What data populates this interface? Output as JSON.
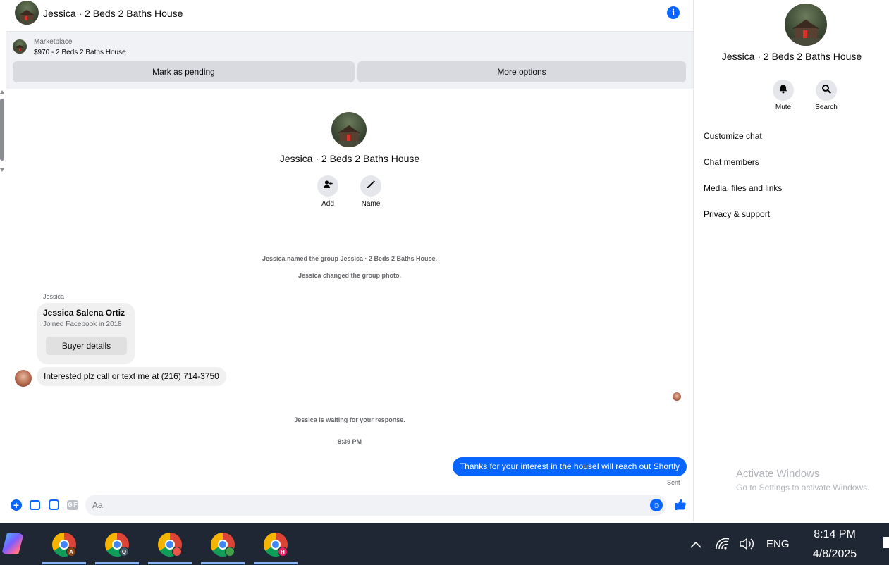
{
  "header": {
    "title": "Jessica · 2 Beds 2 Baths House"
  },
  "marketplace": {
    "label": "Marketplace",
    "listing": "$970 - 2 Beds 2 Baths House",
    "pending_button": "Mark as pending",
    "options_button": "More options"
  },
  "intro": {
    "title": "Jessica · 2 Beds 2 Baths House",
    "add_label": "Add",
    "name_label": "Name"
  },
  "system_messages": [
    "Jessica named the group Jessica · 2 Beds 2 Baths House.",
    "Jessica changed the group photo.",
    "Jessica is waiting for your response.",
    "8:39 PM"
  ],
  "card": {
    "sender": "Jessica",
    "name": "Jessica Salena Ortiz",
    "sub": "Joined Facebook in 2018",
    "button": "Buyer details"
  },
  "messages": {
    "incoming": "Interested plz call or text me at (216) 714-3750",
    "outgoing": "Thanks for your interest in the houseI will reach out Shortly",
    "sent_status": "Sent"
  },
  "composer": {
    "placeholder": "Aa",
    "gif_label": "GIF"
  },
  "panel": {
    "title": "Jessica · 2 Beds 2 Baths House",
    "mute_label": "Mute",
    "search_label": "Search",
    "items": [
      "Customize chat",
      "Chat members",
      "Media, files and links",
      "Privacy & support"
    ]
  },
  "watermark": {
    "title": "Activate Windows",
    "subtitle": "Go to Settings to activate Windows."
  },
  "taskbar": {
    "chrome_badges": [
      "A",
      "Q",
      "",
      "",
      "H"
    ],
    "language": "ENG",
    "time": "8:14 PM",
    "date": "4/8/2025"
  },
  "colors": {
    "accent": "#0866ff",
    "taskbar": "#1e2733"
  }
}
